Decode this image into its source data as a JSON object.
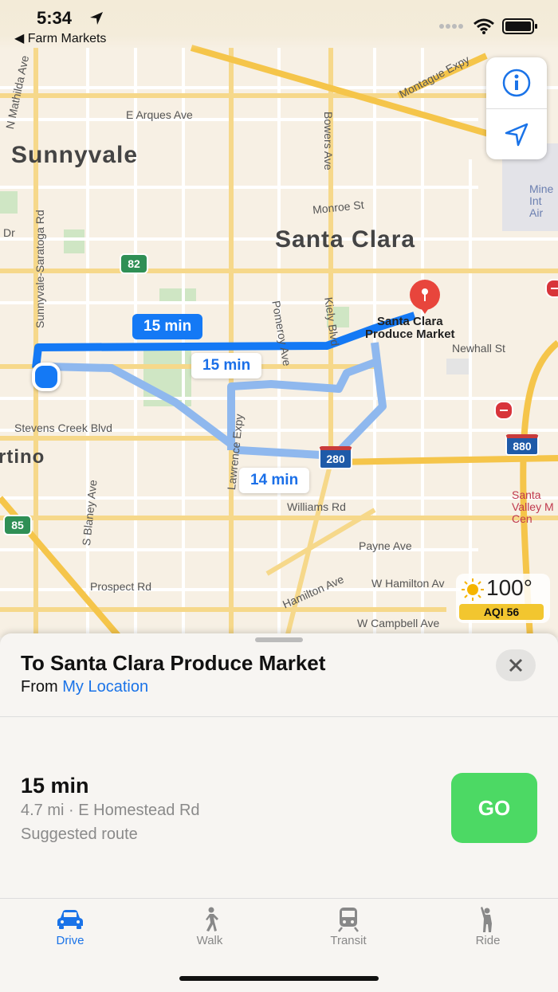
{
  "status_bar": {
    "time": "5:34",
    "back_label": "◀ Farm Markets"
  },
  "map": {
    "cities": [
      "Sunnyvale",
      "Santa Clara",
      "rtino"
    ],
    "streets": {
      "mathilda": "N Mathilda Ave",
      "arques": "E Arques Ave",
      "bowers": "Bowers Ave",
      "montague": "Montague Expy",
      "monroe": "Monroe St",
      "dr": "Dr",
      "saratoga": "Sunnyvale-Saratoga Rd",
      "pomeroy": "Pomeroy Ave",
      "kiely": "Kiely Blvd",
      "newhall": "Newhall St",
      "stevens": "Stevens Creek Blvd",
      "lawrence": "Lawrence Expy",
      "williams": "Williams Rd",
      "blaney": "S Blaney Ave",
      "payne": "Payne Ave",
      "prospect": "Prospect Rd",
      "hamilton": "Hamilton Ave",
      "w_hamilton": "W Hamilton Av",
      "campbell": "W Campbell Ave"
    },
    "shields": [
      "82",
      "85",
      "280",
      "880"
    ],
    "destination": "Santa Clara\nProduce Market",
    "airport_label": "Mine\nInt\nAir",
    "hospital_label": "Santa\nValley M\nCen",
    "route_bubbles": [
      {
        "label": "15 min",
        "selected": true
      },
      {
        "label": "15 min",
        "selected": false
      },
      {
        "label": "14 min",
        "selected": false
      }
    ],
    "route_color": "#1479f5",
    "alt_route_color": "#8fb8ee"
  },
  "map_controls": {
    "info_icon": "info-icon",
    "location_icon": "location-arrow-icon"
  },
  "weather": {
    "temp": "100°",
    "aqi": "AQI 56"
  },
  "sheet": {
    "title": "To Santa Clara Produce Market",
    "from_prefix": "From",
    "from_location": "My Location",
    "route": {
      "time": "15 min",
      "detail": "4.7 mi · E Homestead Rd",
      "subtitle": "Suggested route",
      "go_label": "GO"
    }
  },
  "tabs": [
    {
      "label": "Drive",
      "icon": "car-icon",
      "active": true
    },
    {
      "label": "Walk",
      "icon": "walk-icon",
      "active": false
    },
    {
      "label": "Transit",
      "icon": "train-icon",
      "active": false
    },
    {
      "label": "Ride",
      "icon": "ride-icon",
      "active": false
    }
  ],
  "colors": {
    "accent": "#1a73e8",
    "go": "#4cd964",
    "pin": "#e8453c"
  }
}
